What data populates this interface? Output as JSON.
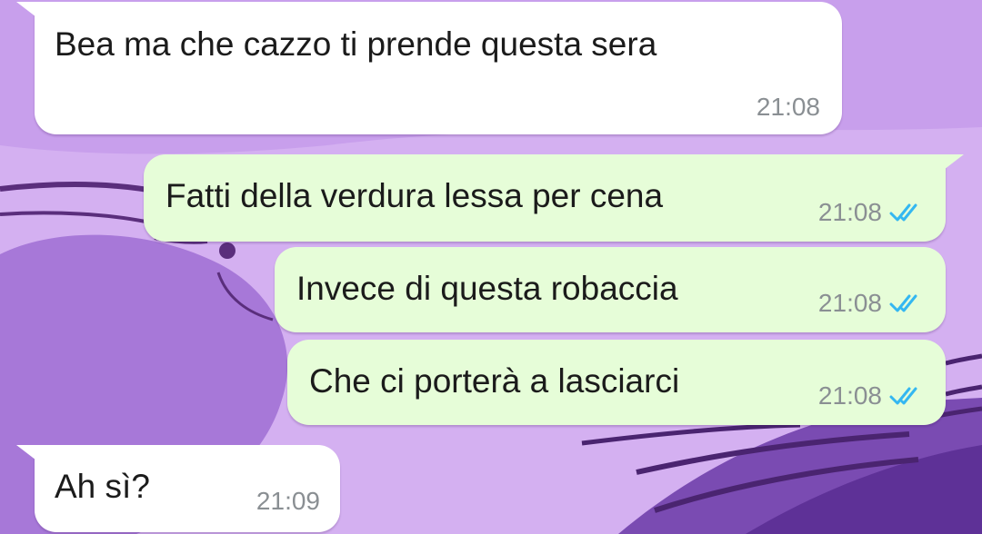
{
  "colors": {
    "incoming_bubble": "#ffffff",
    "outgoing_bubble": "#e6fdd8",
    "read_ticks": "#34b7f1",
    "timestamp": "#8a8f93",
    "wallpaper_base": "#d6b3f2",
    "wallpaper_accent": "#7c4fb3"
  },
  "messages": [
    {
      "direction": "incoming",
      "text": "Bea ma che cazzo ti prende questa sera",
      "time": "21:08"
    },
    {
      "direction": "outgoing",
      "text": "Fatti della verdura lessa per cena",
      "time": "21:08",
      "status_icon": "double-check-read-icon"
    },
    {
      "direction": "outgoing",
      "text": "Invece di questa robaccia",
      "time": "21:08",
      "status_icon": "double-check-read-icon"
    },
    {
      "direction": "outgoing",
      "text": "Che ci porterà a lasciarci",
      "time": "21:08",
      "status_icon": "double-check-read-icon"
    },
    {
      "direction": "incoming",
      "text": "Ah sì?",
      "time": "21:09"
    }
  ]
}
